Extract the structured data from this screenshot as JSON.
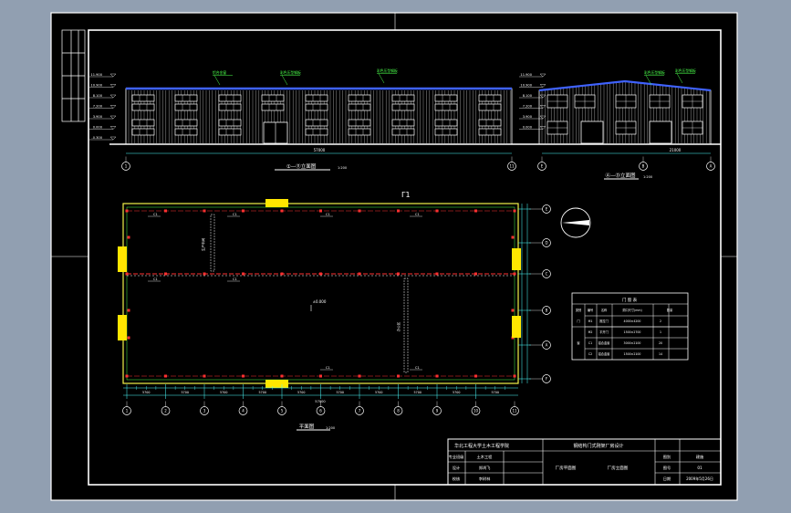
{
  "front_elevation": {
    "title": "①—⑪立面图",
    "scale": "1:200",
    "total_dim": "57000",
    "level_tags": [
      "11.900",
      "10.900",
      "8.100",
      "7.200",
      "3.900",
      "0.000",
      "-0.300"
    ],
    "note_tags": [
      "铝合金窗",
      "彩色压型钢板",
      "彩色压型钢板"
    ]
  },
  "side_elevation": {
    "title": "Ⓐ—Ⓓ立面图",
    "scale": "1:200",
    "total_dim": "21000",
    "level_tags": [
      "11.900",
      "10.900",
      "8.100",
      "7.200",
      "3.900",
      "0.000"
    ],
    "note_tags": [
      "彩色压型钢板",
      "彩色压型钢板"
    ]
  },
  "plan": {
    "title": "平面图",
    "scale": "1:200",
    "section_mark": "Γ1",
    "center_text": "±0.000",
    "room_labels": [
      "生产车间",
      "办公区"
    ],
    "axis_cols": [
      "1",
      "2",
      "3",
      "4",
      "5",
      "6",
      "7",
      "8",
      "9",
      "10",
      "11"
    ],
    "axis_rows": [
      "E",
      "D",
      "C",
      "B",
      "A",
      "F"
    ],
    "dim_segment": "5700",
    "total_dim": "57000",
    "window_tags": [
      "C1",
      "C1",
      "C1",
      "C1",
      "C1",
      "C1",
      "C1",
      "C1"
    ]
  },
  "door_window_table": {
    "title": "门 窗 表",
    "headers": [
      "类别",
      "编号",
      "名称",
      "洞口尺寸(mm)",
      "数量"
    ],
    "rows": [
      [
        "门",
        "M1",
        "推拉门",
        "4000×4200",
        "2"
      ],
      [
        "",
        "M2",
        "平开门",
        "1500×2700",
        "1"
      ],
      [
        "窗",
        "C1",
        "铝合金窗",
        "3000×2100",
        "20"
      ],
      [
        "",
        "C2",
        "铝合金窗",
        "1500×2100",
        "14"
      ]
    ]
  },
  "title_block": {
    "school": "华北工程大学土木工程学院",
    "project": "钢结构门式刚架厂房设计",
    "profession_label": "专业班级",
    "profession_value": "土木工程",
    "design_label": "设计",
    "design_value": "郑鸿飞",
    "checker_label": "校核",
    "checker_value": "李树林",
    "drawing_names": [
      "厂房平面图",
      "厂房立面图"
    ],
    "number_label": "图别",
    "number_value": "建施",
    "sheet_label": "图号",
    "sheet_value": "01",
    "date_label": "日期",
    "date_value": "2009年5月26日"
  },
  "colors": {
    "background": "#919fb1",
    "sheet": "#000000",
    "linework": "#ffffff",
    "wall": "#f2f24a",
    "axis": "#ff3030",
    "roof": "#3f62ff",
    "annotation": "#4bff4b",
    "column": "#ffe600",
    "dimension": "#4dffff"
  }
}
